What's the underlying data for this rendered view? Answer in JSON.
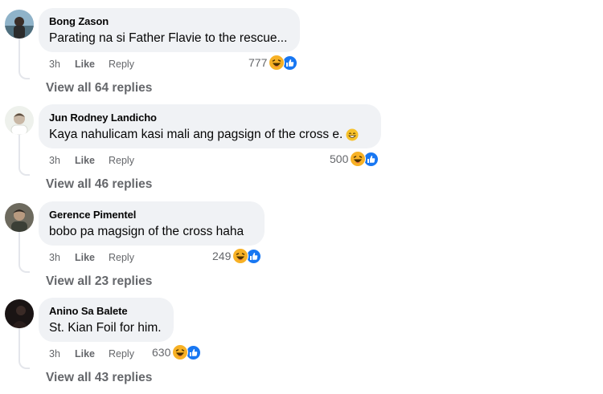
{
  "colors": {
    "bubble": "#f0f2f5",
    "meta": "#65676b",
    "like_blue": "#1877f2",
    "haha_yellow": "#f7b125"
  },
  "icons": {
    "reaction_haha": "haha-icon",
    "reaction_like": "thumbs-up-icon",
    "inline_emoji": "grin-emoji-icon"
  },
  "comments": [
    {
      "author": "Bong Zason",
      "text": "Parating na si Father Flavie to the rescue...",
      "time": "3h",
      "like_label": "Like",
      "reply_label": "Reply",
      "reaction_count": "777",
      "view_replies": "View all 64 replies"
    },
    {
      "author": "Jun Rodney Landicho",
      "text": "Kaya nahulicam kasi mali ang pagsign of the cross e.",
      "time": "3h",
      "like_label": "Like",
      "reply_label": "Reply",
      "reaction_count": "500",
      "view_replies": "View all 46 replies"
    },
    {
      "author": "Gerence Pimentel",
      "text": "bobo pa magsign of the cross haha",
      "time": "3h",
      "like_label": "Like",
      "reply_label": "Reply",
      "reaction_count": "249",
      "view_replies": "View all 23 replies"
    },
    {
      "author": "Anino Sa Balete",
      "text": "St. Kian Foil for him.",
      "time": "3h",
      "like_label": "Like",
      "reply_label": "Reply",
      "reaction_count": "630",
      "view_replies": "View all 43 replies"
    }
  ]
}
